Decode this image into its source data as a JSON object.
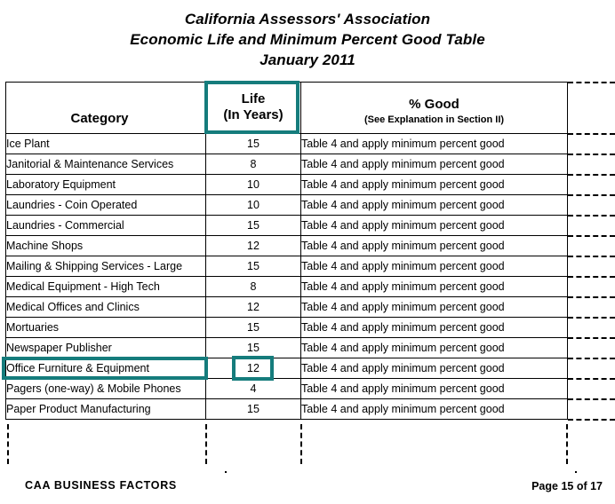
{
  "document": {
    "title_lines": [
      "California Assessors' Association",
      "Economic Life and Minimum Percent Good Table",
      "January 2011"
    ]
  },
  "table": {
    "headers": {
      "category": "Category",
      "life_line1": "Life",
      "life_line2": "(In Years)",
      "good_title": "% Good",
      "good_subtitle": "(See Explanation in Section II)"
    },
    "rows": [
      {
        "category": "Ice Plant",
        "life": "15",
        "good": "Table 4 and apply minimum percent good"
      },
      {
        "category": "Janitorial & Maintenance Services",
        "life": "8",
        "good": "Table 4 and apply minimum percent good"
      },
      {
        "category": "Laboratory Equipment",
        "life": "10",
        "good": "Table 4 and apply minimum percent good"
      },
      {
        "category": "Laundries - Coin Operated",
        "life": "10",
        "good": "Table 4 and apply minimum percent good"
      },
      {
        "category": "Laundries - Commercial",
        "life": "15",
        "good": "Table 4 and apply minimum percent good"
      },
      {
        "category": "Machine Shops",
        "life": "12",
        "good": "Table 4 and apply minimum percent good"
      },
      {
        "category": "Mailing & Shipping Services - Large",
        "life": "15",
        "good": "Table 4 and apply minimum percent good"
      },
      {
        "category": "Medical Equipment - High Tech",
        "life": "8",
        "good": "Table 4 and apply minimum percent good"
      },
      {
        "category": "Medical Offices and Clinics",
        "life": "12",
        "good": "Table 4 and apply minimum percent good"
      },
      {
        "category": "Mortuaries",
        "life": "15",
        "good": "Table 4 and apply minimum percent good"
      },
      {
        "category": "Newspaper Publisher",
        "life": "15",
        "good": "Table 4 and apply minimum percent good"
      },
      {
        "category": "Office Furniture & Equipment",
        "life": "12",
        "good": "Table 4 and apply minimum percent good"
      },
      {
        "category": "Pagers (one-way) & Mobile Phones",
        "life": "4",
        "good": "Table 4 and apply minimum percent good"
      },
      {
        "category": "Paper Product Manufacturing",
        "life": "15",
        "good": "Table 4 and apply minimum percent good"
      }
    ]
  },
  "highlights": {
    "color": "#157c7c",
    "life_header": true,
    "highlighted_row_index": 11,
    "highlighted_row_category": "Office Furniture & Equipment",
    "highlighted_row_life": "12"
  },
  "footer": {
    "left": "CAA BUSINESS FACTORS",
    "right": "Page 15 of 17"
  }
}
